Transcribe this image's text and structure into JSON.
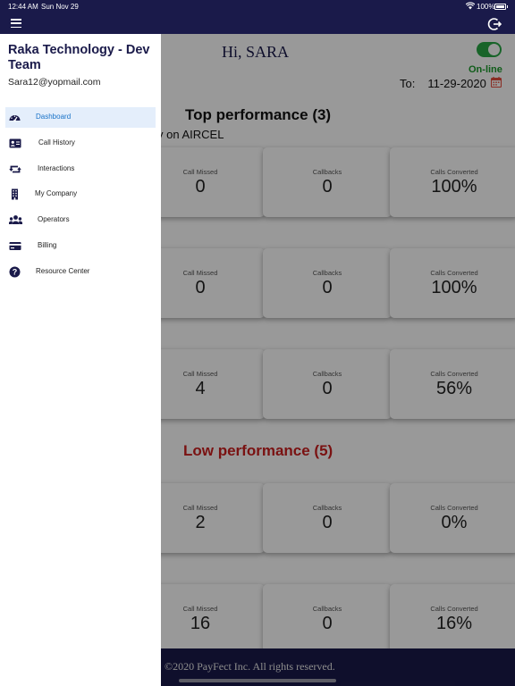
{
  "status_bar": {
    "time": "12:44 AM",
    "date": "Sun Nov 29",
    "battery": "100%"
  },
  "header": {
    "greeting": "Hi, SARA"
  },
  "online": {
    "label": "On-line",
    "enabled": true,
    "color": "#28a745"
  },
  "date_filter": {
    "label": "To:",
    "value": "11-29-2020"
  },
  "sections": {
    "top": {
      "title": "Top performance (3)",
      "color": "#111111"
    },
    "low": {
      "title": "Low performance (5)",
      "color": "#cc1f1f"
    }
  },
  "subtitle": "y on AIRCEL",
  "rows": [
    {
      "missed_label": "Call Missed",
      "missed": "0",
      "callbacks_label": "Callbacks",
      "callbacks": "0",
      "converted_label": "Calls Converted",
      "converted": "100%"
    },
    {
      "missed_label": "Call Missed",
      "missed": "0",
      "callbacks_label": "Callbacks",
      "callbacks": "0",
      "converted_label": "Calls Converted",
      "converted": "100%"
    },
    {
      "missed_label": "Call Missed",
      "missed": "4",
      "callbacks_label": "Callbacks",
      "callbacks": "0",
      "converted_label": "Calls Converted",
      "converted": "56%"
    },
    {
      "missed_label": "Call Missed",
      "missed": "2",
      "callbacks_label": "Callbacks",
      "callbacks": "0",
      "converted_label": "Calls Converted",
      "converted": "0%"
    },
    {
      "missed_label": "Call Missed",
      "missed": "16",
      "callbacks_label": "Callbacks",
      "callbacks": "0",
      "converted_label": "Calls Converted",
      "converted": "16%"
    }
  ],
  "footer": {
    "copyright": "©2020 PayFect Inc. All rights reserved."
  },
  "drawer": {
    "company": "Raka Technology - Dev Team",
    "email": "Sara12@yopmail.com",
    "items": [
      {
        "label": "Dashboard",
        "icon": "dashboard-gauge-icon",
        "active": true
      },
      {
        "label": "Call History",
        "icon": "id-card-icon",
        "active": false
      },
      {
        "label": "Interactions",
        "icon": "retweet-arrows-icon",
        "active": false
      },
      {
        "label": "My Company",
        "icon": "building-icon",
        "active": false
      },
      {
        "label": "Operators",
        "icon": "users-icon",
        "active": false
      },
      {
        "label": "Billing",
        "icon": "credit-card-icon",
        "active": false
      },
      {
        "label": "Resource Center",
        "icon": "question-circle-icon",
        "active": false
      }
    ]
  },
  "colors": {
    "navy": "#1a1a4a",
    "accent_blue": "#1a73c8",
    "active_bg": "#e4eefb",
    "calendar": "#e74c3c"
  }
}
